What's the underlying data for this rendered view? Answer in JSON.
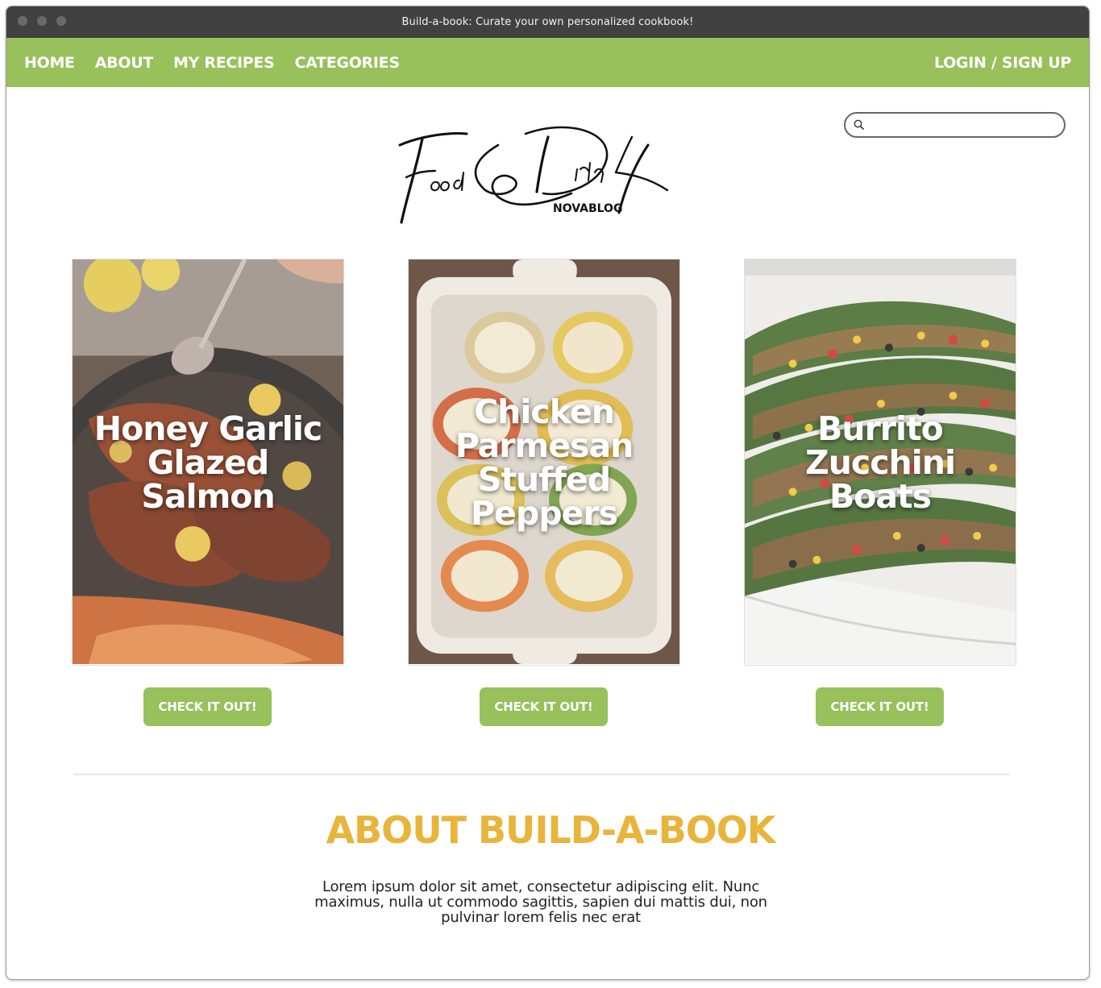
{
  "window": {
    "title": "Build-a-book: Curate your own personalized cookbook!"
  },
  "nav": {
    "links": [
      "HOME",
      "ABOUT",
      "MY RECIPES",
      "CATEGORIES"
    ],
    "login": "LOGIN / SIGN UP",
    "bg_color": "#98c05b"
  },
  "search": {
    "placeholder": "",
    "value": "",
    "icon": "search-icon"
  },
  "logo": {
    "script_text": "Food & Drink",
    "sub_text": "NOVABLOG"
  },
  "recipes": [
    {
      "title": "Honey Garlic Glazed Salmon",
      "button": "CHECK IT OUT!"
    },
    {
      "title": "Chicken Parmesan Stuffed Peppers",
      "button": "CHECK IT OUT!"
    },
    {
      "title": "Burrito Zucchini Boats",
      "button": "CHECK IT OUT!"
    }
  ],
  "about": {
    "title": "ABOUT BUILD-A-BOOK",
    "body": "Lorem ipsum dolor sit amet, consectetur adipiscing elit. Nunc maximus, nulla ut commodo sagittis, sapien dui mattis dui, non pulvinar lorem felis nec erat",
    "title_color": "#e8b43a"
  }
}
